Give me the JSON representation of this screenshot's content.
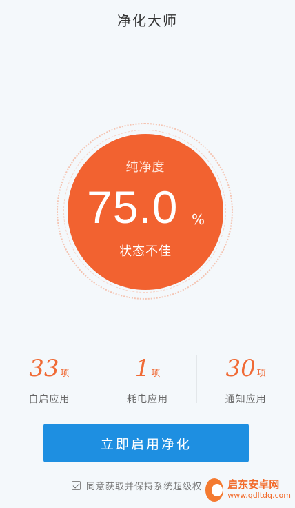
{
  "header": {
    "title": "净化大师"
  },
  "gauge": {
    "label": "纯净度",
    "value": "75.0",
    "unit": "%",
    "status": "状态不佳",
    "accent_color": "#f26230"
  },
  "stats": [
    {
      "number": "33",
      "unit": "项",
      "label": "自启应用"
    },
    {
      "number": "1",
      "unit": "项",
      "label": "耗电应用"
    },
    {
      "number": "30",
      "unit": "项",
      "label": "通知应用"
    }
  ],
  "cta": {
    "label": "立即启用净化",
    "color": "#1e8fe1"
  },
  "agreement": {
    "text": "同意获取并保持系统超级权",
    "checked": true
  },
  "watermark": {
    "name": "启东安卓网",
    "url": "www.qdltdq.com",
    "icon": "watermark-logo-icon"
  }
}
